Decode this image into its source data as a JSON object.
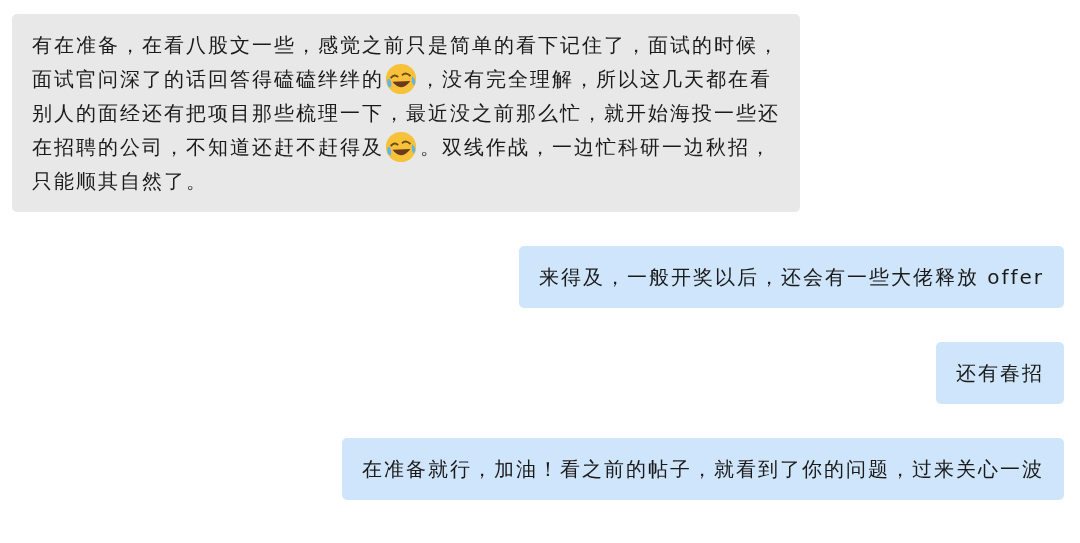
{
  "messages": [
    {
      "kind": "received",
      "lines": [
        [
          {
            "kind": "text",
            "text": "有在准备，在看八股文一些，感觉之前只是简单的看下记住了，面试的时候，"
          }
        ],
        [
          {
            "kind": "text",
            "text": "面试官问深了的话回答得磕磕绊绊的"
          },
          {
            "kind": "emoji"
          },
          {
            "kind": "text",
            "text": "，没有完全理解，所以这几天都在看"
          }
        ],
        [
          {
            "kind": "text",
            "text": "别人的面经还有把项目那些梳理一下，最近没之前那么忙，就开始海投一些还"
          }
        ],
        [
          {
            "kind": "text",
            "text": "在招聘的公司，不知道还赶不赶得及"
          },
          {
            "kind": "emoji"
          },
          {
            "kind": "text",
            "text": "。双线作战，一边忙科研一边秋招，"
          }
        ],
        [
          {
            "kind": "text",
            "text": "只能顺其自然了。"
          }
        ]
      ]
    },
    {
      "kind": "sent",
      "lines": [
        [
          {
            "kind": "text",
            "text": "来得及，一般开奖以后，还会有一些大佬释放 offer"
          }
        ]
      ]
    },
    {
      "kind": "sent",
      "lines": [
        [
          {
            "kind": "text",
            "text": "还有春招"
          }
        ]
      ]
    },
    {
      "kind": "sent",
      "lines": [
        [
          {
            "kind": "text",
            "text": "在准备就行，加油！看之前的帖子，就看到了你的问题，过来关心一波"
          }
        ]
      ]
    }
  ]
}
